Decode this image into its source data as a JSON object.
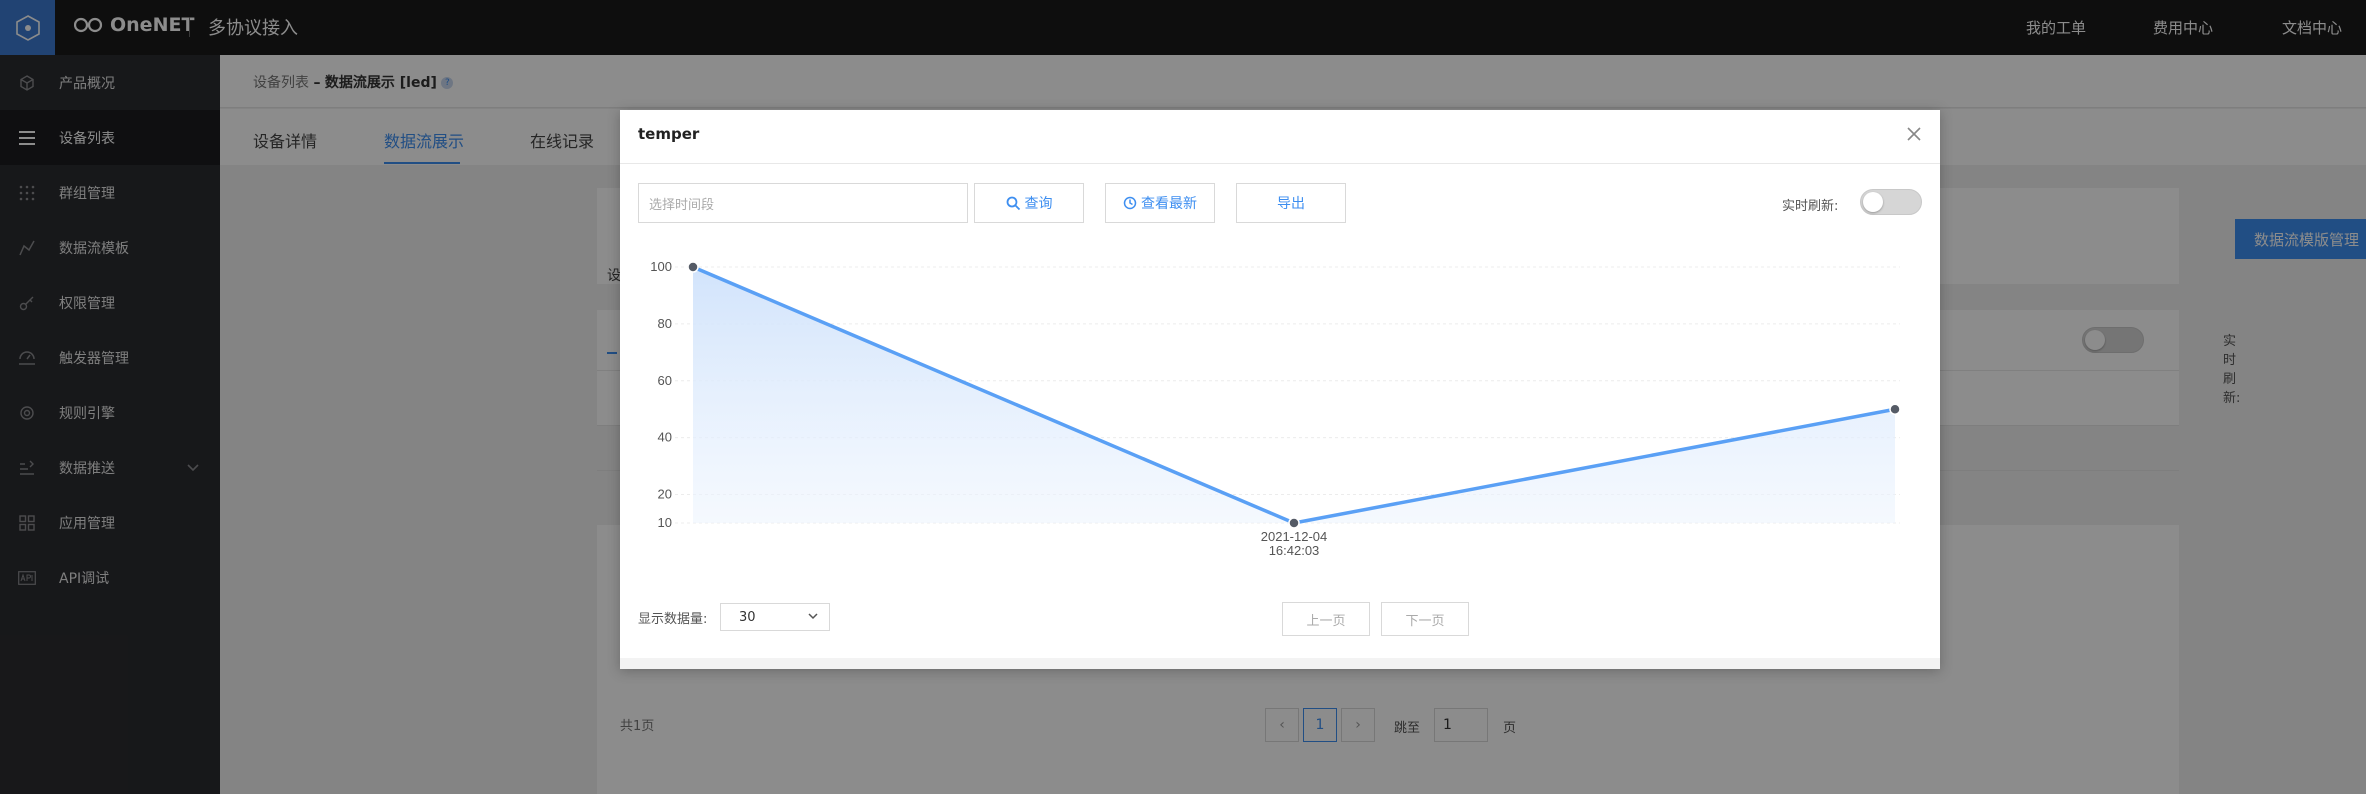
{
  "topbar": {
    "brand": "OneNET",
    "product": "多协议接入",
    "nav": [
      "我的工单",
      "费用中心",
      "文档中心"
    ]
  },
  "sidebar": {
    "items": [
      {
        "label": "产品概况",
        "icon": "cube-icon"
      },
      {
        "label": "设备列表",
        "icon": "list-icon",
        "active": true
      },
      {
        "label": "群组管理",
        "icon": "grid-dots-icon"
      },
      {
        "label": "数据流模板",
        "icon": "line-chart-icon"
      },
      {
        "label": "权限管理",
        "icon": "key-icon"
      },
      {
        "label": "触发器管理",
        "icon": "trigger-icon"
      },
      {
        "label": "规则引擎",
        "icon": "rule-engine-icon"
      },
      {
        "label": "数据推送",
        "icon": "push-icon",
        "has_children": true
      },
      {
        "label": "应用管理",
        "icon": "apps-icon"
      },
      {
        "label": "API调试",
        "icon": "api-icon"
      }
    ]
  },
  "breadcrumb": {
    "parent": "设备列表",
    "separator": "–",
    "current": "数据流展示 [led]"
  },
  "tabs": [
    "设备详情",
    "数据流展示",
    "在线记录"
  ],
  "active_tab": "数据流展示",
  "background": {
    "cut_label": "设",
    "template_button": "数据流模版管理",
    "realtime_label": "实时刷新:",
    "pager": {
      "total": "共1页",
      "prev": "‹",
      "current": "1",
      "next": "›",
      "jump_label": "跳至",
      "jump_value": "1",
      "page_unit": "页"
    }
  },
  "modal": {
    "title": "temper",
    "date_placeholder": "选择时间段",
    "query_label": "查询",
    "latest_label": "查看最新",
    "export_label": "导出",
    "realtime_label": "实时刷新:",
    "realtime_on": false,
    "count_label": "显示数据量:",
    "count_value": "30",
    "prev_page": "上一页",
    "next_page": "下一页"
  },
  "chart_data": {
    "type": "area",
    "y_ticks": [
      100,
      80,
      60,
      40,
      20,
      10
    ],
    "ylim": [
      10,
      100
    ],
    "points": [
      {
        "y": 100,
        "label": ""
      },
      {
        "y": 10,
        "label": "2021-12-04\n16:42:03"
      },
      {
        "y": 50,
        "label": ""
      }
    ],
    "x_tick_labels": [
      "2021-12-04",
      "16:42:03"
    ],
    "line_color": "#5aa0f5",
    "fill_color": "#cfe2fb",
    "marker_color": "#555b66",
    "grid": true
  },
  "colors": {
    "accent": "#3d8ef0",
    "topbar": "#1a1a1a",
    "sidebar": "#2b2c30",
    "logo_bg": "#3c7bd1"
  }
}
